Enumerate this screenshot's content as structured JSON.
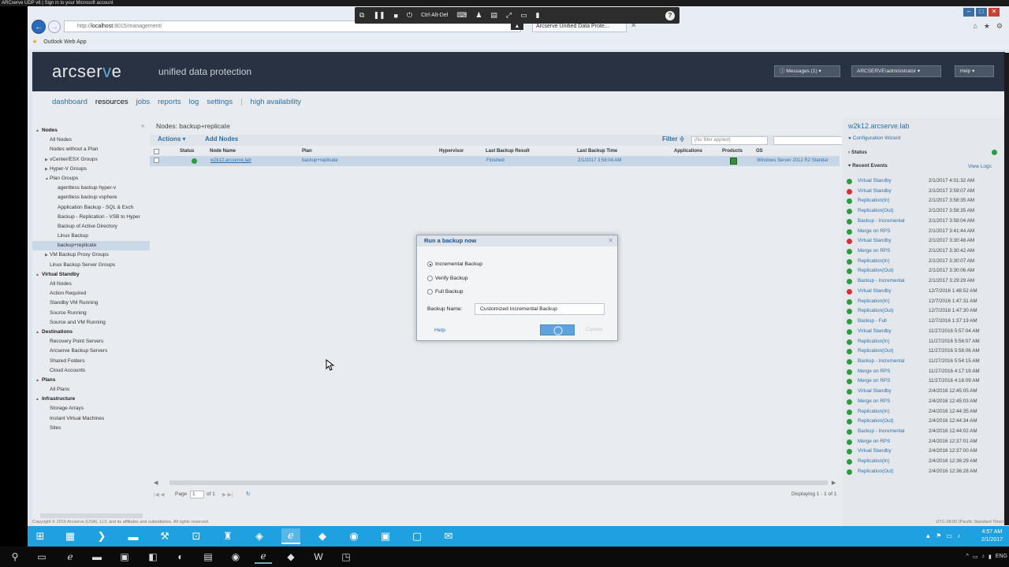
{
  "top_strip": "ARCserve UDP v6  |  Sign in to your Microsoft account",
  "browser": {
    "url_prefix": "http://",
    "url_host": "localhost",
    "url_rest": ":8015/management/",
    "tab_title": "Arcserve Unified Data Prote...",
    "favorite": "Outlook Web App"
  },
  "remote_toolbar": {
    "cad_label": "Ctrl-Alt-Del"
  },
  "header": {
    "logo_a": "arcser",
    "logo_e": "v",
    "logo_b": "e",
    "tagline": "unified data protection",
    "messages": "Messages (1)",
    "user": "ARCSERVE\\administrator",
    "help": "Help"
  },
  "menu": {
    "dashboard": "dashboard",
    "resources": "resources",
    "jobs": "jobs",
    "reports": "reports",
    "log": "log",
    "settings": "settings",
    "ha": "high availability"
  },
  "tree": [
    {
      "label": "Nodes",
      "level": 0,
      "toggle": "▲"
    },
    {
      "label": "All Nodes",
      "level": 1
    },
    {
      "label": "Nodes without a Plan",
      "level": 1
    },
    {
      "label": "vCenter/ESX Groups",
      "level": 1,
      "toggle": "▶"
    },
    {
      "label": "Hyper-V Groups",
      "level": 1,
      "toggle": "▶"
    },
    {
      "label": "Plan Groups",
      "level": 1,
      "toggle": "▲"
    },
    {
      "label": "agentless backup hyper-v",
      "level": 2
    },
    {
      "label": "agentless backup vsphere",
      "level": 2
    },
    {
      "label": "Application Backup - SQL & Exch",
      "level": 2
    },
    {
      "label": "Backup - Replication - VSB to Hyper",
      "level": 2
    },
    {
      "label": "Backup of Active Directory",
      "level": 2
    },
    {
      "label": "Linux Backup",
      "level": 2
    },
    {
      "label": "backup+replicate",
      "level": 2,
      "selected": true
    },
    {
      "label": "VM Backup Proxy Groups",
      "level": 1,
      "toggle": "▶"
    },
    {
      "label": "Linux Backup Server Groups",
      "level": 1
    },
    {
      "label": "Virtual Standby",
      "level": 0,
      "toggle": "▲"
    },
    {
      "label": "All Nodes",
      "level": 1
    },
    {
      "label": "Action Required",
      "level": 1
    },
    {
      "label": "Standby VM Running",
      "level": 1
    },
    {
      "label": "Source Running",
      "level": 1
    },
    {
      "label": "Source and VM Running",
      "level": 1
    },
    {
      "label": "Destinations",
      "level": 0,
      "toggle": "▲"
    },
    {
      "label": "Recovery Point Servers",
      "level": 1
    },
    {
      "label": "Arcserve Backup Servers",
      "level": 1
    },
    {
      "label": "Shared Folders",
      "level": 1
    },
    {
      "label": "Cloud Accounts",
      "level": 1
    },
    {
      "label": "Plans",
      "level": 0,
      "toggle": "▲"
    },
    {
      "label": "All Plans",
      "level": 1
    },
    {
      "label": "Infrastructure",
      "level": 0,
      "toggle": "▲"
    },
    {
      "label": "Storage Arrays",
      "level": 1
    },
    {
      "label": "Instant Virtual Machines",
      "level": 1
    },
    {
      "label": "Sites",
      "level": 1
    }
  ],
  "grid": {
    "breadcrumb": "Nodes: backup+replicate",
    "actions": "Actions ▾",
    "add_nodes": "Add Nodes",
    "filter": "Filter ≑",
    "filter_placeholder": "(No filter applied)",
    "columns": {
      "status": "Status",
      "node_name": "Node Name",
      "plan": "Plan",
      "hypervisor": "Hypervisor",
      "last_result": "Last Backup Result",
      "last_time": "Last Backup Time",
      "applications": "Applications",
      "products": "Products",
      "os": "OS"
    },
    "row": {
      "node_name": "w2k12.arcserve.lab",
      "plan": "backup+replicate",
      "last_result": "Finished",
      "last_time": "2/1/2017 3:58:04 AM",
      "os": "Windows Server 2012 R2 Standar"
    },
    "page_label": "Page",
    "page_value": "1",
    "page_of": "of 1",
    "displaying": "Displaying 1 - 1 of 1"
  },
  "right_panel": {
    "title": "w2k12.arcserve.lab",
    "wizard": "Configuration Wizard",
    "status": "Status",
    "recent": "Recent Events",
    "view_logs": "View Logs",
    "events": [
      {
        "name": "Virtual Standby",
        "time": "2/1/2017 4:01:32 AM",
        "state": "ok"
      },
      {
        "name": "Virtual Standby",
        "time": "2/1/2017 3:59:07 AM",
        "state": "err"
      },
      {
        "name": "Replication(In)",
        "time": "2/1/2017 3:58:35 AM",
        "state": "ok"
      },
      {
        "name": "Replication(Out)",
        "time": "2/1/2017 3:58:35 AM",
        "state": "ok"
      },
      {
        "name": "Backup - Incremental",
        "time": "2/1/2017 3:58:04 AM",
        "state": "ok"
      },
      {
        "name": "Merge on RPS",
        "time": "2/1/2017 3:41:44 AM",
        "state": "ok"
      },
      {
        "name": "Virtual Standby",
        "time": "2/1/2017 3:30:48 AM",
        "state": "err"
      },
      {
        "name": "Merge on RPS",
        "time": "2/1/2017 3:30:42 AM",
        "state": "ok"
      },
      {
        "name": "Replication(In)",
        "time": "2/1/2017 3:30:07 AM",
        "state": "ok"
      },
      {
        "name": "Replication(Out)",
        "time": "2/1/2017 3:30:06 AM",
        "state": "ok"
      },
      {
        "name": "Backup - Incremental",
        "time": "2/1/2017 3:29:29 AM",
        "state": "ok"
      },
      {
        "name": "Virtual Standby",
        "time": "12/7/2016 1:48:52 AM",
        "state": "err"
      },
      {
        "name": "Replication(In)",
        "time": "12/7/2016 1:47:31 AM",
        "state": "ok"
      },
      {
        "name": "Replication(Out)",
        "time": "12/7/2016 1:47:30 AM",
        "state": "ok"
      },
      {
        "name": "Backup - Full",
        "time": "12/7/2016 1:37:19 AM",
        "state": "ok"
      },
      {
        "name": "Virtual Standby",
        "time": "11/27/2016 5:57:04 AM",
        "state": "ok"
      },
      {
        "name": "Replication(In)",
        "time": "11/27/2016 5:56:07 AM",
        "state": "ok"
      },
      {
        "name": "Replication(Out)",
        "time": "11/27/2016 5:56:06 AM",
        "state": "ok"
      },
      {
        "name": "Backup - Incremental",
        "time": "11/27/2016 5:54:15 AM",
        "state": "ok"
      },
      {
        "name": "Merge on RPS",
        "time": "11/27/2016 4:17:19 AM",
        "state": "ok"
      },
      {
        "name": "Merge on RPS",
        "time": "11/27/2016 4:16:09 AM",
        "state": "ok"
      },
      {
        "name": "Virtual Standby",
        "time": "2/4/2016 12:45:05 AM",
        "state": "ok"
      },
      {
        "name": "Merge on RPS",
        "time": "2/4/2016 12:45:03 AM",
        "state": "ok"
      },
      {
        "name": "Replication(In)",
        "time": "2/4/2016 12:44:35 AM",
        "state": "ok"
      },
      {
        "name": "Replication(Out)",
        "time": "2/4/2016 12:44:34 AM",
        "state": "ok"
      },
      {
        "name": "Backup - Incremental",
        "time": "2/4/2016 12:44:02 AM",
        "state": "ok"
      },
      {
        "name": "Merge on RPS",
        "time": "2/4/2016 12:37:01 AM",
        "state": "ok"
      },
      {
        "name": "Virtual Standby",
        "time": "2/4/2016 12:37:00 AM",
        "state": "ok"
      },
      {
        "name": "Replication(In)",
        "time": "2/4/2016 12:36:29 AM",
        "state": "ok"
      },
      {
        "name": "Replication(Out)",
        "time": "2/4/2016 12:36:28 AM",
        "state": "ok"
      }
    ]
  },
  "dialog": {
    "title": "Run a backup now",
    "opt_incremental": "Incremental Backup",
    "opt_verify": "Verify Backup",
    "opt_full": "Full Backup",
    "selected_option": "Incremental Backup",
    "name_label": "Backup Name:",
    "name_value": "Customized Incremental Backup",
    "help": "Help",
    "cancel": "Cancel"
  },
  "footer": {
    "copyright": "Copyright © 2016 Arcserve (USA), LLC and its affiliates and subsidiaries. All rights reserved.",
    "timezone": "UTC-08:00 (Pacific Standard Time)"
  },
  "tray": {
    "time": "4:57 AM",
    "date": "2/1/2017",
    "lang": "ENG"
  },
  "colors": {
    "accent": "#2f6fa6",
    "header_bg": "#283243",
    "taskbar": "#1fa0e0",
    "ok": "#2e9b3c",
    "error": "#d3303a"
  }
}
